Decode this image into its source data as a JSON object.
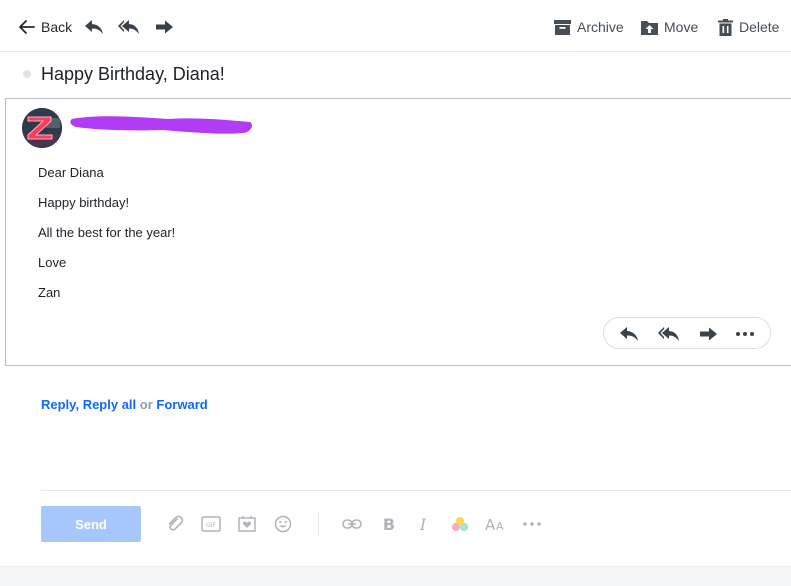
{
  "toolbar": {
    "back_label": "Back",
    "archive_label": "Archive",
    "move_label": "Move",
    "delete_label": "Delete",
    "icons": [
      "back-arrow-icon",
      "reply-icon",
      "reply-all-icon",
      "forward-icon",
      "archive-icon",
      "move-icon",
      "trash-icon"
    ]
  },
  "message": {
    "subject": "Happy Birthday, Diana!",
    "sender_name_redacted": true,
    "body_lines": [
      "Dear Diana",
      "Happy birthday!",
      "All the best for the year!",
      "Love",
      "Zan"
    ],
    "actions": [
      "reply-icon",
      "reply-all-icon",
      "forward-icon",
      "more-icon"
    ]
  },
  "reply_links": {
    "reply": "Reply",
    "comma": ",",
    "reply_all": "Reply all",
    "or": "or",
    "forward": "Forward"
  },
  "compose": {
    "send_label": "Send",
    "tools": [
      "attachment-icon",
      "gif-icon",
      "sticker-icon",
      "emoji-icon",
      "link-icon",
      "bold-icon",
      "italic-icon",
      "color-icon",
      "font-size-icon",
      "more-icon"
    ]
  },
  "colors": {
    "accent": "#0f69ff",
    "send_disabled": "#a6c8ff",
    "redaction": "#b23cf6",
    "text": "#1d2228"
  }
}
